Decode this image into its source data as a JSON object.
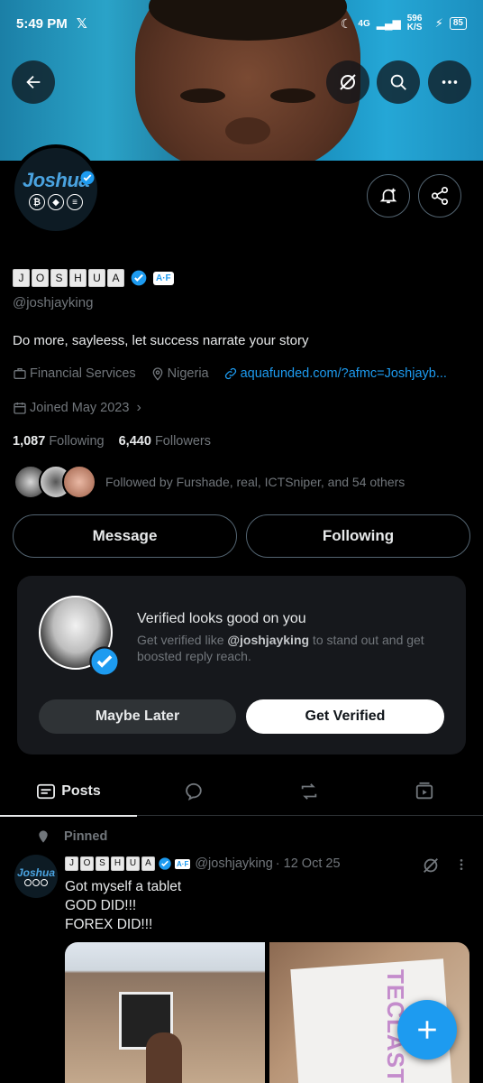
{
  "status_bar": {
    "time": "5:49 PM",
    "network": "4G",
    "speed": "596 K/S",
    "battery": "85"
  },
  "profile": {
    "avatar_text": "Joshua",
    "display_name_letters": [
      "J",
      "O",
      "S",
      "H",
      "U",
      "A"
    ],
    "badge": "A·F",
    "handle": "@joshjayking",
    "bio": "Do more, sayleess, let success narrate your story",
    "category": "Financial Services",
    "location": "Nigeria",
    "website": "aquafunded.com/?afmc=Joshjayb...",
    "joined": "Joined May 2023",
    "following_count": "1,087",
    "following_label": "Following",
    "followers_count": "6,440",
    "followers_label": "Followers",
    "followed_by": "Followed by Furshade, real, ICTSniper, and 54 others"
  },
  "actions": {
    "message": "Message",
    "following": "Following"
  },
  "verify_card": {
    "title": "Verified looks good on you",
    "body_prefix": "Get verified like ",
    "body_handle": "@joshjayking",
    "body_suffix": " to stand out and get boosted reply reach.",
    "maybe_later": "Maybe Later",
    "get_verified": "Get Verified"
  },
  "tabs": {
    "posts": "Posts"
  },
  "post": {
    "pinned_label": "Pinned",
    "handle": "@joshjayking",
    "date": "· 12 Oct 25",
    "text_line1": "Got myself a tablet",
    "text_line2": "GOD DID!!!",
    "text_line3": "FOREX DID!!!",
    "image2_text": "TECLAST"
  },
  "colors": {
    "accent": "#1d9bf0",
    "background": "#000000",
    "muted": "#71767b"
  }
}
